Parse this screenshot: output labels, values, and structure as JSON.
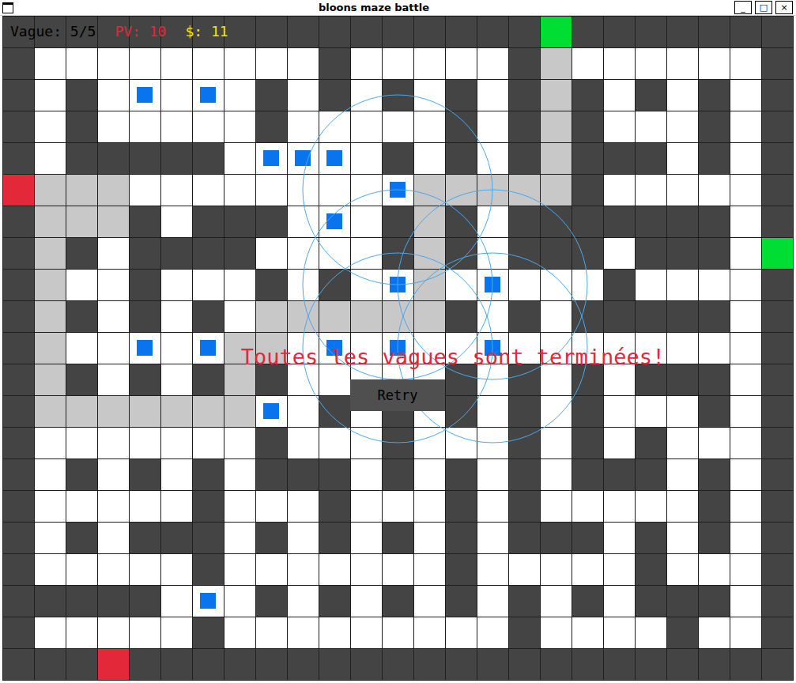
{
  "window": {
    "title": "bloons maze battle",
    "controls": [
      "_",
      "□",
      "×"
    ]
  },
  "hud": {
    "wave": "Vague: 5/5",
    "lives": "PV: 10",
    "money": "$: 11"
  },
  "board": {
    "rows": [
      "#################G#######",
      "#.........#.....#P......#",
      "#.#.T.T.#.#.#.#.#P#.#.#.#",
      "#.#.....#.....#.#P#...#.#",
      "#.#####.TTT.#.#.#P###.#.#",
      "RPPP........OPPPPP#.....#",
      "#PPP#.###.T.#P#.#######.#",
      "#P#.####....#P#.###.###.G",
      "#P..#...#.#.OP.O...#....#",
      "#P#.#.#.PPPPPP#.#.#####.#",
      "#P..T.TPP.T.O..O........#",
      "#P#.#.#P#.....#.#.#.###.#",
      "#PPPPPPPT.#.#.#.#.#...#.#",
      "#.......#...#...#.#.#...#",
      "#.#.#.#.###.#.#.#.###.#.#",
      "#.....#...#...#.#.....#.#",
      "#.#.###.#.#.#.#.###.#.#.#",
      "#.....#.......#.....#...#",
      "#####.T.#.#.#.#.#.#.###.#",
      "#.....#.........#....#..#",
      "###R#####################"
    ]
  },
  "message": "Toutes les vagues sont terminées!",
  "buttons": [
    "Retry"
  ]
}
